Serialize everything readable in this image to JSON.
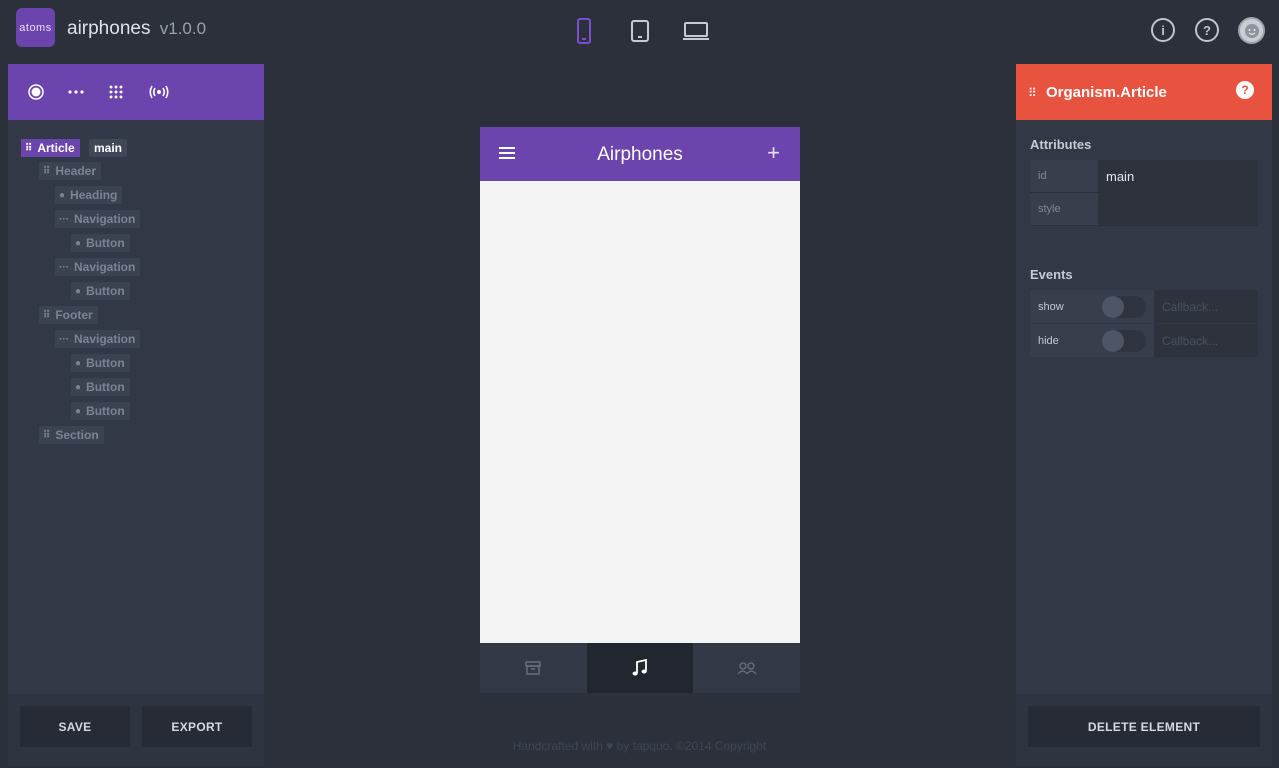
{
  "app": {
    "logo_text": "atoms",
    "name": "airphones",
    "version": "v1.0.0"
  },
  "devices": [
    {
      "name": "phone",
      "active": true
    },
    {
      "name": "tablet",
      "active": false
    },
    {
      "name": "desktop",
      "active": false
    }
  ],
  "top_right": {
    "info": "i",
    "help": "?"
  },
  "left_toolbar": {
    "tools": [
      "atom-icon",
      "molecule-icon",
      "organism-icon",
      "broadcast-icon"
    ]
  },
  "tree": {
    "root": {
      "label": "Article",
      "id": "main"
    },
    "nodes": [
      {
        "label": "Header",
        "kind": "organism"
      },
      {
        "label": "Heading",
        "kind": "atom"
      },
      {
        "label": "Navigation",
        "kind": "molecule"
      },
      {
        "label": "Button",
        "kind": "atom"
      },
      {
        "label": "Navigation",
        "kind": "molecule"
      },
      {
        "label": "Button",
        "kind": "atom"
      },
      {
        "label": "Footer",
        "kind": "organism"
      },
      {
        "label": "Navigation",
        "kind": "molecule"
      },
      {
        "label": "Button",
        "kind": "atom"
      },
      {
        "label": "Button",
        "kind": "atom"
      },
      {
        "label": "Button",
        "kind": "atom"
      },
      {
        "label": "Section",
        "kind": "organism"
      }
    ]
  },
  "left_footer": {
    "save": "SAVE",
    "export": "EXPORT"
  },
  "phone": {
    "title": "Airphones",
    "tabs": [
      {
        "icon": "archive-icon",
        "active": false
      },
      {
        "icon": "music-icon",
        "active": true
      },
      {
        "icon": "people-icon",
        "active": false
      }
    ]
  },
  "footer": {
    "text": "Handcrafted with ♥ by tapquo. ©2014 Copyright"
  },
  "inspector": {
    "title": "Organism.Article",
    "help": "?",
    "attributes_title": "Attributes",
    "attributes": [
      {
        "key": "id",
        "value": "main"
      },
      {
        "key": "style",
        "value": ""
      }
    ],
    "events_title": "Events",
    "events": [
      {
        "key": "show",
        "placeholder": "Callback..."
      },
      {
        "key": "hide",
        "placeholder": "Callback..."
      }
    ],
    "delete": "DELETE ELEMENT"
  },
  "colors": {
    "accent": "#6b44ad",
    "inspector": "#e8533f",
    "background": "#2b303b"
  }
}
